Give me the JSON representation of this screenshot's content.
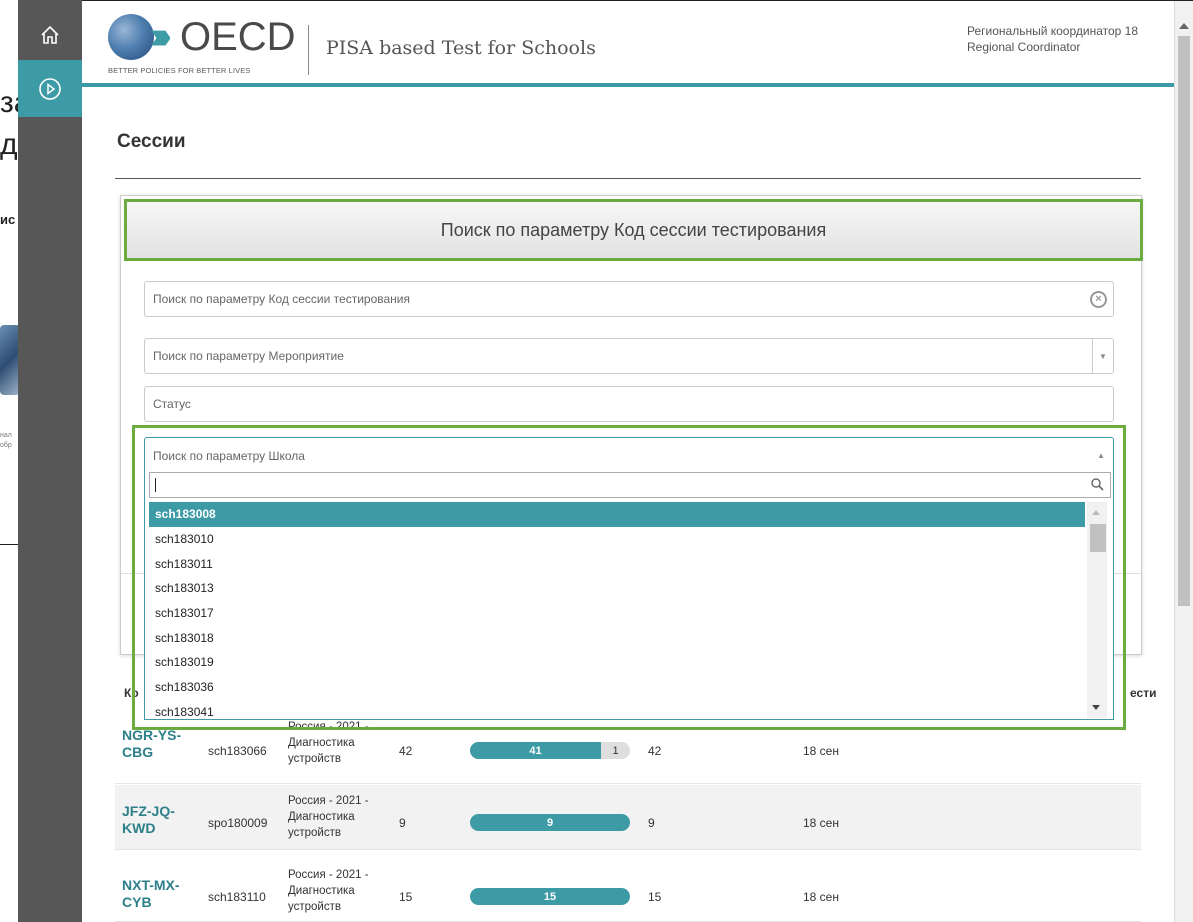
{
  "background_window": {
    "text_fragments": [
      "за",
      "д",
      "ис",
      "нал",
      "обр"
    ]
  },
  "rail": {
    "home_icon": "home-icon",
    "play_icon": "play-circle-icon"
  },
  "header": {
    "logo_text": "OECD",
    "logo_tagline": "BETTER POLICIES FOR BETTER LIVES",
    "app_title": "PISA based Test for Schools",
    "user_line1": "Региональный координатор 18",
    "user_line2": "Regional Coordinator"
  },
  "page": {
    "title": "Сессии"
  },
  "search_panel": {
    "heading": "Поиск по параметру Код сессии тестирования",
    "session_code_placeholder": "Поиск по параметру Код сессии тестирования",
    "event_placeholder": "Поиск по параметру Мероприятие",
    "status_placeholder": "Статус",
    "school_placeholder": "Поиск по параметру Школа"
  },
  "school_dropdown": {
    "search_value": "",
    "options": [
      "sch183008",
      "sch183010",
      "sch183011",
      "sch183013",
      "sch183017",
      "sch183018",
      "sch183019",
      "sch183036",
      "sch183041"
    ],
    "active_index": 0
  },
  "table": {
    "header_left_partial": "Ко",
    "header_right_partial": "ести",
    "rows": [
      {
        "code_line1": "NGR-YS-",
        "code_line2": "CBG",
        "school": "sch183066",
        "event_line1": "Россия - 2021 -",
        "event_line2": "Диагностика",
        "event_line3": "устройств",
        "count": "42",
        "bar_value": "41",
        "bar_rest": "1",
        "bar_fraction": 0.976,
        "count2": "42",
        "date": "18 сен"
      },
      {
        "code_line1": "JFZ-JQ-",
        "code_line2": "KWD",
        "school": "spo180009",
        "event_line1": "Россия - 2021 -",
        "event_line2": "Диагностика",
        "event_line3": "устройств",
        "count": "9",
        "bar_value": "9",
        "bar_rest": "",
        "bar_fraction": 1,
        "count2": "9",
        "date": "18 сен"
      },
      {
        "code_line1": "NXT-MX-",
        "code_line2": "CYB",
        "school": "sch183110",
        "event_line1": "Россия - 2021 -",
        "event_line2": "Диагностика",
        "event_line3": "устройств",
        "count": "15",
        "bar_value": "15",
        "bar_rest": "",
        "bar_fraction": 1,
        "count2": "15",
        "date": "18 сен"
      }
    ]
  },
  "colors": {
    "accent": "#3d9ba6",
    "highlight_border": "#6bab3f",
    "rail": "#575757"
  }
}
